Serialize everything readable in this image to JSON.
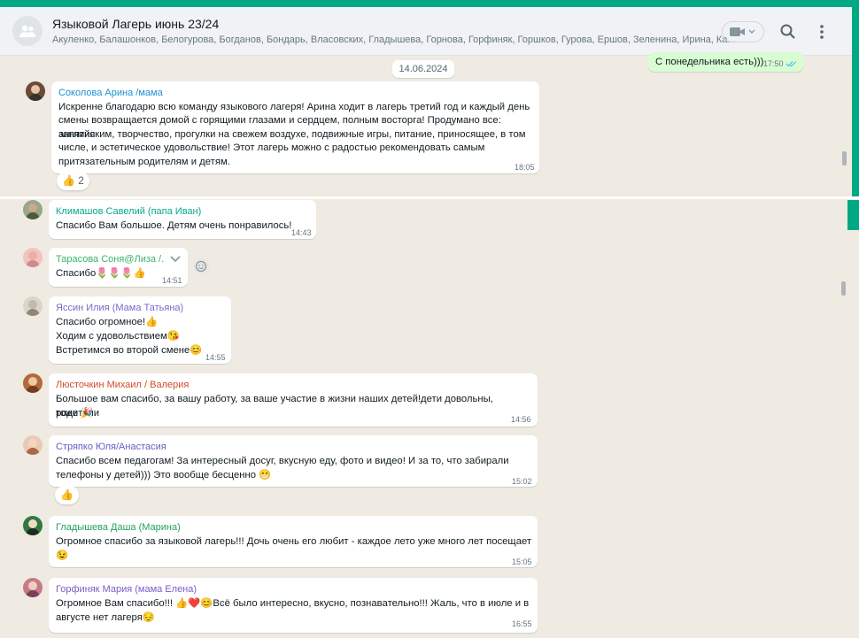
{
  "header": {
    "title": "Языковой Лагерь июнь 23/24",
    "members": "Акуленко, Балашонков, Белогурова, Богданов, Бондарь, Власовских, Гладышева, Горнова, Горфиняк, Горшков, Гурова, Ершов, Зеленина, Ирина, Ка..."
  },
  "date_chip": "14.06.2024",
  "outgoing": {
    "text": "С понедельника есть)))",
    "time": "17:50"
  },
  "messages": [
    {
      "sender": "Соколова Арина /мама",
      "color": "#1d8fd1",
      "lines": [
        "Искренне благодарю всю команду языкового лагеря! Арина ходит в лагерь третий год и каждый день",
        "смены возвращается домой с горящими глазами и сердцем, полным восторга! Продумано все: занятия",
        "английским, творчество, прогулки на свежем воздухе, подвижные игры, питание, приносящее, в том",
        "числе, и эстетическое удовольствие! Этот лагерь можно с радостью рекомендовать самым",
        "притязательным родителям и детям."
      ],
      "time": "18:05",
      "reaction": "👍 2"
    },
    {
      "sender": "Климашов Савелий (папа Иван)",
      "color": "#06a88f",
      "lines": [
        "Спасибо Вам большое. Детям очень понравилось!"
      ],
      "time": "14:43"
    },
    {
      "sender": "Тарасова Соня@Лиза /...",
      "color": "#3bb26b",
      "lines": [
        "Спасибо🌷🌷🌷👍"
      ],
      "time": "14:51"
    },
    {
      "sender": "Яссин Илия (Мама Татьяна)",
      "color": "#7f66c9",
      "lines": [
        "Спасибо огромное!👍",
        "Ходим с удовольствием😘",
        "Встретимся во второй смене😊"
      ],
      "time": "14:55"
    },
    {
      "sender": "Люсточкин Михаил / Валерия",
      "color": "#d24b2a",
      "lines": [
        "Большое вам спасибо, за вашу работу, за ваше участие в жизни наших детей!дети довольны, родители",
        "тоже 🎉"
      ],
      "time": "14:56"
    },
    {
      "sender": "Стряпко Юля/Анастасия",
      "color": "#6c5bc4",
      "lines": [
        "Спасибо всем педагогам! За интересный досуг, вкусную еду, фото и видео! И за то, что забирали",
        "телефоны у детей))) Это вообще бесценно 😁"
      ],
      "time": "15:02",
      "reaction": "👍"
    },
    {
      "sender": "Гладышева Даша (Марина)",
      "color": "#25a35a",
      "lines": [
        "Огромное спасибо за языковой лагерь!!! Дочь очень его любит - каждое лето уже много лет посещает",
        "😉"
      ],
      "time": "15:05"
    },
    {
      "sender": "Горфиняк Мария (мама Елена)",
      "color": "#7b5cc8",
      "lines": [
        "Огромное Вам спасибо!!! 👍❤️😊Всё было интересно, вкусно, познавательно!!! Жаль, что в июле и в",
        "августе нет лагеря😔"
      ],
      "time": "16:55"
    }
  ]
}
